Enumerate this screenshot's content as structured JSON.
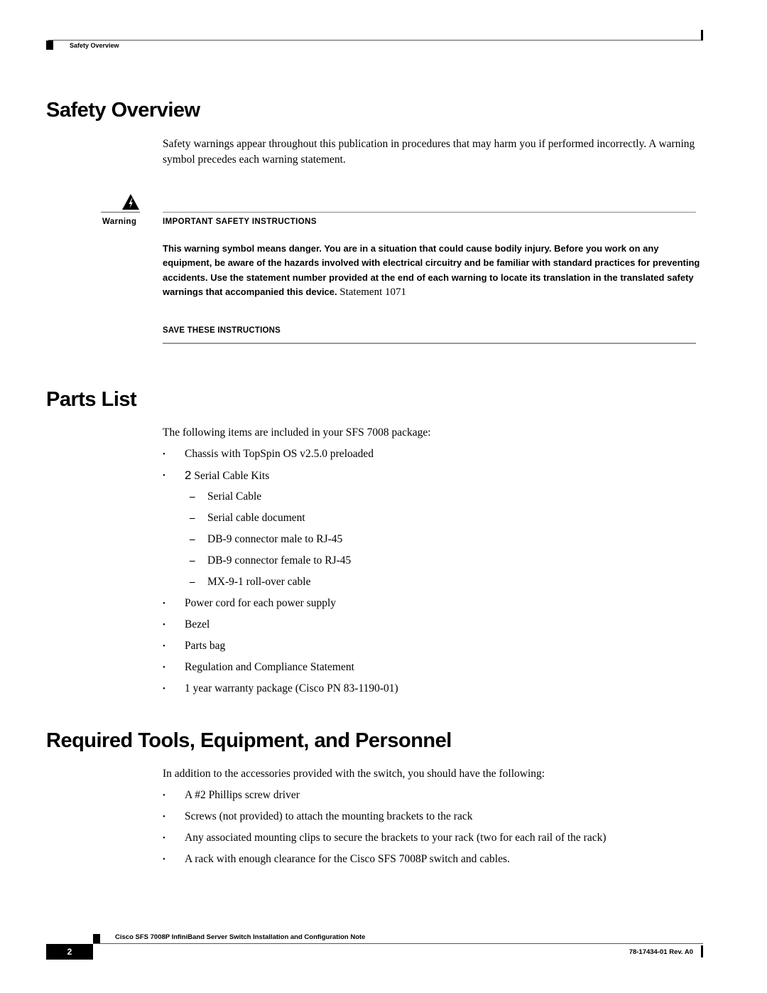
{
  "header": {
    "running_title": "Safety Overview"
  },
  "safety": {
    "heading": "Safety Overview",
    "intro": "Safety warnings appear throughout this publication in procedures that may harm you if performed incorrectly. A warning symbol precedes each warning statement.",
    "warning": {
      "icon": "electrical-hazard-warning-icon",
      "label": "Warning",
      "title": "IMPORTANT SAFETY INSTRUCTIONS",
      "body": "This warning symbol means danger. You are in a situation that could cause bodily injury. Before you work on any equipment, be aware of the hazards involved with electrical circuitry and be familiar with standard practices for preventing accidents. Use the statement number provided at the end of each warning to locate its translation in the translated safety warnings that accompanied this device.",
      "statement": "Statement 1071",
      "save_label": "SAVE THESE INSTRUCTIONS"
    }
  },
  "parts": {
    "heading": "Parts List",
    "intro": "The following items are included in your SFS 7008 package:",
    "items": [
      {
        "bullet": "•",
        "text": "Chassis with TopSpin OS v2.5.0 preloaded",
        "level": 1
      },
      {
        "bullet": "•",
        "number": "2",
        "text": " Serial Cable Kits",
        "level": 1
      },
      {
        "bullet": "–",
        "text": "Serial Cable",
        "level": 2
      },
      {
        "bullet": "–",
        "text": "Serial cable document",
        "level": 2
      },
      {
        "bullet": "–",
        "text": "DB-9 connector male to RJ-45",
        "level": 2
      },
      {
        "bullet": "–",
        "text": "DB-9 connector female to RJ-45",
        "level": 2
      },
      {
        "bullet": "–",
        "text": "MX-9-1 roll-over cable",
        "level": 2
      },
      {
        "bullet": "•",
        "text": "Power cord for each power supply",
        "level": 1
      },
      {
        "bullet": "•",
        "text": "Bezel",
        "level": 1
      },
      {
        "bullet": "•",
        "text": "Parts bag",
        "level": 1
      },
      {
        "bullet": "•",
        "text": "Regulation and Compliance Statement",
        "level": 1
      },
      {
        "bullet": "•",
        "text": "1 year warranty package (Cisco PN 83-1190-01)",
        "level": 1
      }
    ]
  },
  "tools": {
    "heading": "Required Tools, Equipment, and Personnel",
    "intro": "In addition to the accessories provided with the switch, you should have the following:",
    "items": [
      {
        "bullet": "•",
        "text": "A #2 Phillips screw driver"
      },
      {
        "bullet": "•",
        "text": "Screws (not provided) to attach the mounting brackets to the rack"
      },
      {
        "bullet": "•",
        "text": "Any associated mounting clips to secure the brackets to your rack (two for each rail of the rack)"
      },
      {
        "bullet": "•",
        "text": "A rack with enough clearance for the Cisco SFS 7008P switch and cables."
      }
    ]
  },
  "footer": {
    "doc_title": "Cisco SFS 7008P InfiniBand Server Switch Installation and Configuration Note",
    "page_number": "2",
    "doc_code": "78-17434-01 Rev. A0"
  }
}
